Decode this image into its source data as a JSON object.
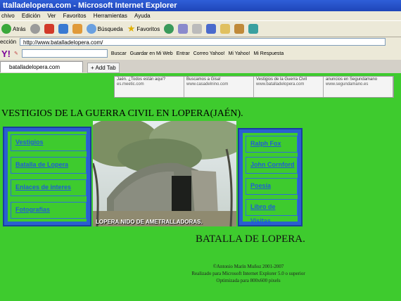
{
  "window": {
    "title": "ttalladelopera.com - Microsoft Internet Explorer"
  },
  "menu": [
    "chivo",
    "Edición",
    "Ver",
    "Favoritos",
    "Herramientas",
    "Ayuda"
  ],
  "toolbar": {
    "back": "Atrás",
    "search": "Búsqueda",
    "favorites": "Favoritos"
  },
  "address": {
    "label": "ección",
    "url": "http://www.batalladelopera.com/"
  },
  "yahoo": {
    "logo": "Y!",
    "buscar": "Buscar",
    "guardar": "Guardar en Mi Web",
    "entrar": "Entrar",
    "correo": "Correo Yahoo!",
    "myyahoo": "Mi Yahoo!",
    "respuestas": "Mi Respuesta"
  },
  "tabs": {
    "active": "batalladelopera.com",
    "add": "Add Tab"
  },
  "ads": [
    {
      "title": "Jaén. ¿Todos están aquí?",
      "url": "es.meetic.com"
    },
    {
      "title": "Buscamos a Gisa!",
      "url": "www.casadelnino.com"
    },
    {
      "title": "Vestigios de la Guerra Civil",
      "url": "www.batalladelopera.com"
    },
    {
      "title": "anuncios en Segundamano",
      "url": "www.segundamano.es"
    }
  ],
  "site": {
    "heading": "VESTIGIOS DE LA GUERRA CIVIL EN LOPERA(JAÉN).",
    "left_nav": [
      "Vestigios",
      "Batalla de Lopera",
      "Enlaces de interes",
      "Fotografias"
    ],
    "right_nav": [
      "Ralph Fox",
      "John Cornford",
      "Poesía",
      "Libro de Visitas"
    ],
    "photo_caption": "LOPERA.NIDO DE AMETRALLADORAS.",
    "subheading": "BATALLA DE LOPERA.",
    "footer": [
      "©Antonio Marín Muñoz 2001-2007",
      "Realizado para Microsoft Internet Explorer 5.0 o superior",
      "Optimizada para 800x600 pixels"
    ]
  },
  "colors": {
    "page_bg": "#3ecb2e",
    "nav_frame": "#2a5fd0",
    "link": "#1f5bd9"
  }
}
